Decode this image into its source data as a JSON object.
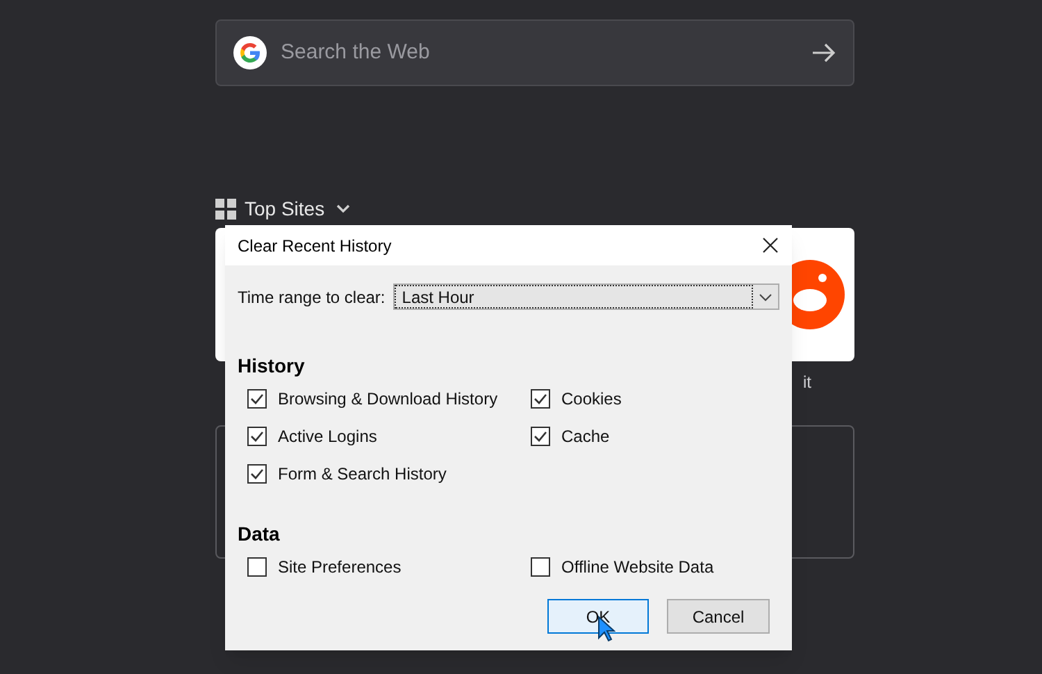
{
  "search": {
    "placeholder": "Search the Web"
  },
  "top_sites": {
    "label": "Top Sites",
    "tile_label": "it"
  },
  "dialog": {
    "title": "Clear Recent History",
    "time_range": {
      "label": "Time range to clear:",
      "value": "Last Hour"
    },
    "sections": [
      {
        "heading": "History",
        "items": [
          {
            "label": "Browsing & Download History",
            "checked": true
          },
          {
            "label": "Cookies",
            "checked": true
          },
          {
            "label": "Active Logins",
            "checked": true
          },
          {
            "label": "Cache",
            "checked": true
          },
          {
            "label": "Form & Search History",
            "checked": true
          }
        ]
      },
      {
        "heading": "Data",
        "items": [
          {
            "label": "Site Preferences",
            "checked": false
          },
          {
            "label": "Offline Website Data",
            "checked": false
          }
        ]
      }
    ],
    "buttons": [
      {
        "label": "OK",
        "focused": true
      },
      {
        "label": "Cancel",
        "focused": false
      }
    ]
  }
}
